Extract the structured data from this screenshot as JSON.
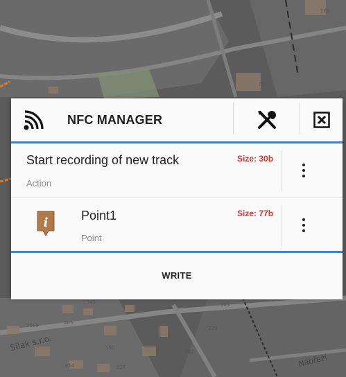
{
  "map": {
    "labels": {
      "company": "Silak s.r.o.",
      "street": "Nábřeží"
    },
    "numbers": [
      "715",
      "165",
      "2569",
      "405",
      "614",
      "827",
      "150",
      "143",
      "229",
      "1345",
      "341"
    ]
  },
  "dialog": {
    "title": "NFC MANAGER",
    "header_icon": "nfc-signal-icon",
    "tools_icon": "tools-icon",
    "close_icon": "close-box-icon",
    "items": [
      {
        "title": "Start recording of new track",
        "type": "Action",
        "size": "Size: 30b",
        "menu_icon": "more-vert-icon"
      },
      {
        "title": "Point1",
        "type": "Point",
        "size": "Size: 77b",
        "icon": "info-point-icon",
        "icon_letter": "i",
        "menu_icon": "more-vert-icon"
      }
    ],
    "write_label": "WRITE"
  },
  "colors": {
    "accent": "#3b82d6",
    "size_text": "#d8352f",
    "point_icon": "#b07a4a",
    "map_bg": "#5d5d5d"
  }
}
